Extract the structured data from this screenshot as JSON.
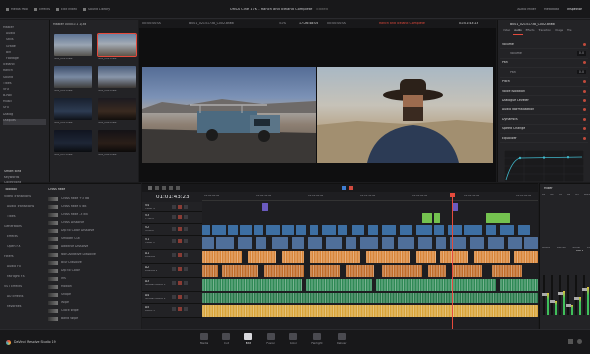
{
  "topbar": {
    "items": [
      "Media Pool",
      "Effects",
      "Edit Index",
      "Sound Library",
      "Inspector"
    ],
    "right_items": [
      "Audio Mixer",
      "Metadata"
    ],
    "project_title": "URSA Cine 17K - Ranch and Iceland Complete",
    "edited": "Edited",
    "inspector": "Inspector"
  },
  "media": {
    "header": "Master 00001:1 1/3d",
    "bins": [
      "Master",
      "Audio",
      "Stills",
      "Grade",
      "Bin",
      "Footage",
      "Iceland",
      "Ranch",
      "Sound",
      "Titles",
      "VFX",
      "B-Roll",
      "Music",
      "SFX",
      "Dialog",
      "Outputs"
    ],
    "clips": [
      "IMG_001.braw",
      "IMG_002.braw",
      "IMG_003.braw",
      "IMG_004.braw",
      "IMG_005.braw",
      "IMG_006.braw",
      "IMG_007.braw",
      "IMG_008.braw"
    ],
    "smart_bins": "Smart Bins",
    "smart_items": [
      "Keywords",
      "Collections"
    ]
  },
  "viewer": {
    "left_name": "B001_02151738_C002.braw",
    "left_tc": "00:00:00:00",
    "zoom": "51%",
    "mid_tc": "17:26:48:05",
    "mid_tc2": "00:00:00:00",
    "center_title": "Ranch and Iceland Complete",
    "right_tc": "01:01:43:23",
    "timeline_tc": "01:01:43:23"
  },
  "inspector": {
    "clip_name": "B001_02151738_C002.braw",
    "tabs": [
      "Video",
      "Audio",
      "Effects",
      "Transition",
      "Image",
      "File"
    ],
    "sections": [
      {
        "label": "Volume",
        "value": ""
      },
      {
        "label": "Volume",
        "value": "0.0"
      },
      {
        "label": "Pan",
        "value": ""
      },
      {
        "label": "Pan",
        "value": "0.0"
      },
      {
        "label": "Pitch",
        "value": ""
      },
      {
        "label": "Voice Isolation",
        "value": ""
      },
      {
        "label": "Dialogue Leveler",
        "value": ""
      },
      {
        "label": "Audio Normalization",
        "value": ""
      },
      {
        "label": "Dynamics",
        "value": ""
      },
      {
        "label": "Speed Change",
        "value": ""
      },
      {
        "label": "Equalizer",
        "value": ""
      }
    ]
  },
  "toolbox": {
    "title": "Toolbox",
    "items": [
      "Video Transitions",
      "Audio Transitions",
      "Titles",
      "Generators",
      "Effects",
      "Open FX",
      "Filters",
      "Audio FX",
      "Fairlight FX",
      "VST Effects",
      "AU Effects",
      "Favorites"
    ],
    "fx_title": "Cross Fade",
    "fx": [
      "Cross Fade +3 dB",
      "Cross Fade 0 dB",
      "Cross Fade -3 dB",
      "Cross Dissolve",
      "Dip to Color Dissolve",
      "Smooth Cut",
      "Additive Dissolve",
      "Non-Additive Dissolve",
      "Blur Dissolve",
      "Dip to Color",
      "Iris",
      "Motion",
      "Shape",
      "Wipe",
      "Clock Wipe",
      "Band Wipe"
    ]
  },
  "timeline": {
    "timecode": "01:01:43:23",
    "ruler": [
      "01:00:00:00",
      "01:00:30:00",
      "01:01:00:00",
      "01:01:30:00",
      "01:02:00:00",
      "01:02:30:00",
      "01:03:00:00"
    ],
    "tracks": [
      {
        "id": "V4",
        "name": "Video 4"
      },
      {
        "id": "V3",
        "name": "TITLES"
      },
      {
        "id": "V2",
        "name": "STILLS"
      },
      {
        "id": "V1",
        "name": "Video 1"
      },
      {
        "id": "A1",
        "name": "DIALOG"
      },
      {
        "id": "A2",
        "name": "DIALOG 2"
      },
      {
        "id": "A3",
        "name": "SOUNDTRACK 1"
      },
      {
        "id": "A4",
        "name": "SOUNDTRACK 2"
      },
      {
        "id": "A5",
        "name": "Audio 5"
      }
    ]
  },
  "mixer": {
    "title": "Mixer",
    "channels": [
      "A1",
      "A2",
      "A3",
      "A4",
      "A5",
      "Bus1"
    ],
    "master": "Bus 1",
    "channel_labels": [
      "DIALOG",
      "SNDTRK",
      "SOUND",
      "M1"
    ]
  },
  "pages": [
    "Media",
    "Cut",
    "Edit",
    "Fusion",
    "Color",
    "Fairlight",
    "Deliver"
  ],
  "active_page": "Edit",
  "bottom": {
    "app_name": "DaVinci Resolve Studio 19"
  },
  "colors": {
    "accent": "#e54a3c",
    "video_clip": "#3d6fa3",
    "audio_orange": "#d8863a",
    "audio_green": "#2f8a56",
    "title_green": "#74c24f"
  }
}
